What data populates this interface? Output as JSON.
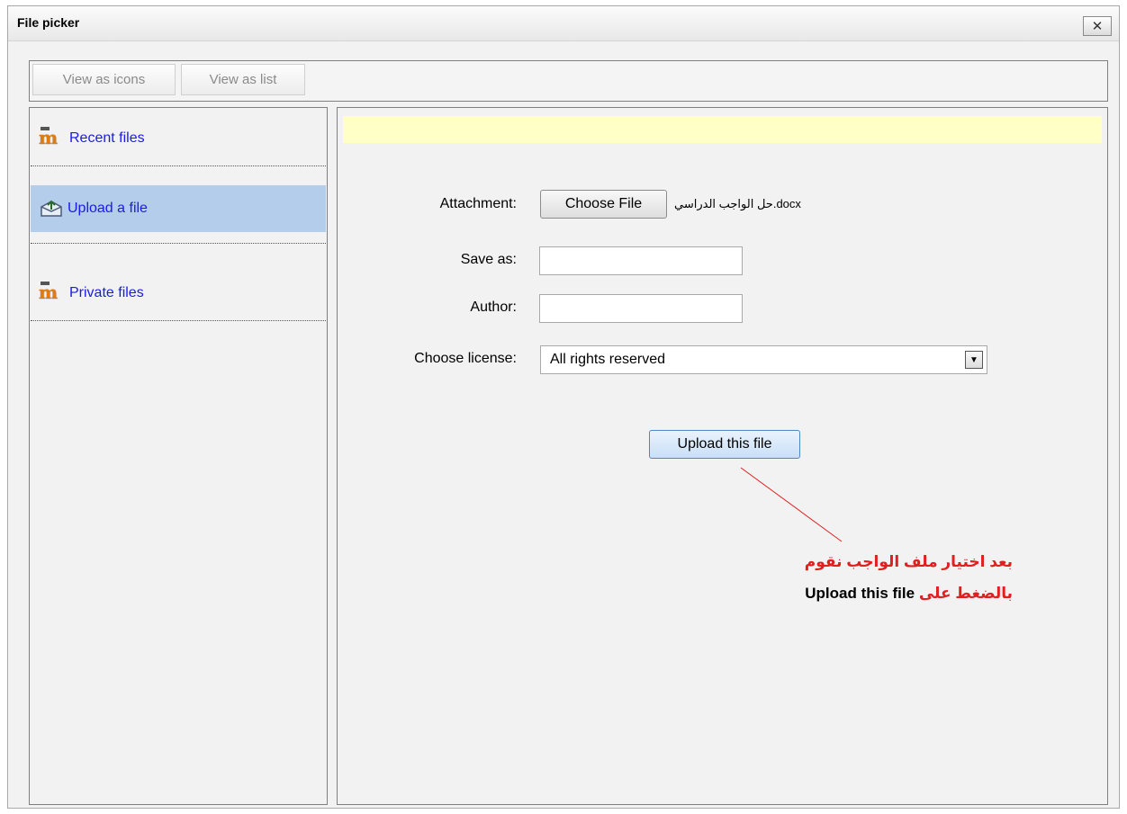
{
  "dialog": {
    "title": "File picker",
    "close_symbol": "✕"
  },
  "toolbar": {
    "view_icons": "View as icons",
    "view_list": "View as list"
  },
  "sidebar": {
    "items": [
      {
        "label": "Recent files",
        "icon": "moodle-icon",
        "selected": false
      },
      {
        "label": "Upload a file",
        "icon": "upload-icon",
        "selected": true
      },
      {
        "label": "Private files",
        "icon": "moodle-icon",
        "selected": false
      }
    ]
  },
  "form": {
    "attachment_label": "Attachment:",
    "choose_file_button": "Choose File",
    "chosen_file": "حل الواجب الدراسي.docx",
    "save_as_label": "Save as:",
    "save_as_value": "",
    "author_label": "Author:",
    "author_value": "",
    "license_label": "Choose license:",
    "license_value": "All rights reserved",
    "upload_button": "Upload this file"
  },
  "annotation": {
    "line1": "بعد اختيار ملف الواجب نقوم",
    "line2_arabic": "بالضغط على",
    "line2_english": "Upload this file",
    "color_red": "#e02020",
    "color_black": "#000000"
  },
  "colors": {
    "selected_item_bg": "#b3cdea",
    "notice_bg": "#ffffc6",
    "link_blue": "#1a1aee"
  }
}
